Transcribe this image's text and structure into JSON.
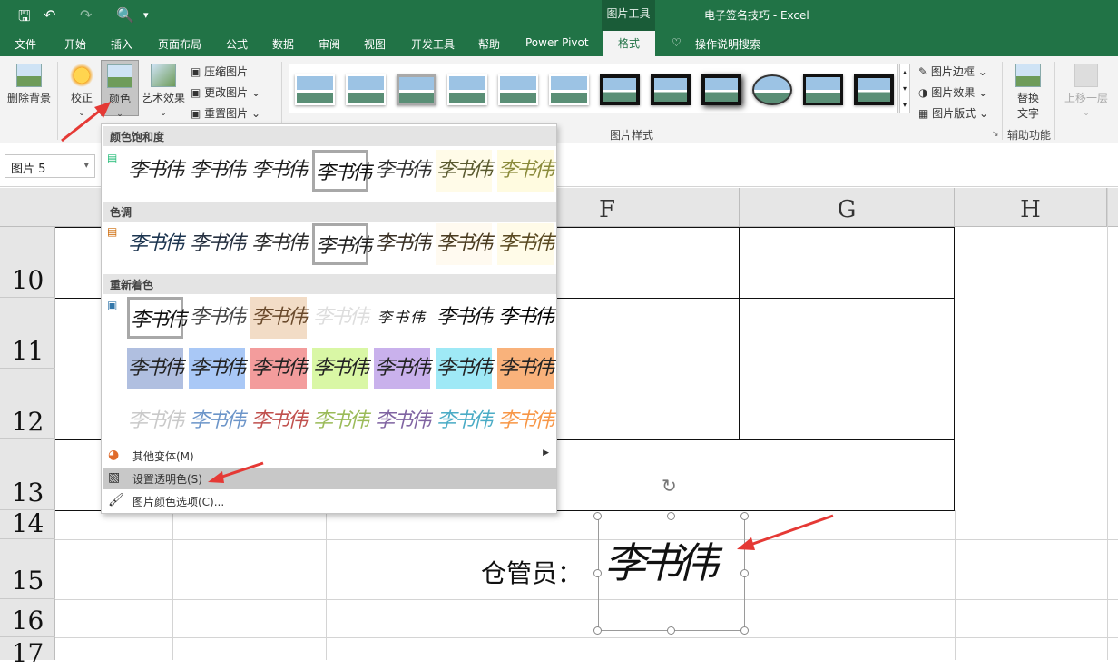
{
  "app": {
    "document_title": "电子签名技巧 - Excel",
    "context_tool": "图片工具"
  },
  "tabs": [
    "文件",
    "开始",
    "插入",
    "页面布局",
    "公式",
    "数据",
    "审阅",
    "视图",
    "开发工具",
    "帮助",
    "Power Pivot",
    "格式",
    "操作说明搜索"
  ],
  "ribbon": {
    "remove_bg": "删除背景",
    "correct": "校正",
    "color": "颜色",
    "artistic": "艺术效果",
    "compress": "压缩图片",
    "change": "更改图片",
    "reset": "重置图片",
    "styles_group": "图片样式",
    "border": "图片边框",
    "effects": "图片效果",
    "layout": "图片版式",
    "alt_text_1": "替换",
    "alt_text_2": "文字",
    "accessibility": "辅助功能",
    "bring_forward": "上移一层"
  },
  "namebox": "图片 5",
  "columns": [
    "F",
    "G",
    "H"
  ],
  "rows": [
    "10",
    "11",
    "12",
    "13",
    "14",
    "15",
    "16",
    "17"
  ],
  "menu": {
    "saturation_header": "颜色饱和度",
    "tone_header": "色调",
    "recolor_header": "重新着色",
    "more_variants": "其他变体(M)",
    "set_transparent": "设置透明色(S)",
    "color_options": "图片颜色选项(C)...",
    "thumb_text": "李书伟",
    "recolor_fills": [
      "#b0bfe0",
      "#a9c8f6",
      "#f39c9c",
      "#d9f7a5",
      "#c9b1ec",
      "#9fe9f6",
      "#f9b27b"
    ],
    "recolor_inks": [
      "#c9c9c9",
      "#6c95c9",
      "#c0504d",
      "#9bbb59",
      "#8064a2",
      "#4bacc6",
      "#f79646"
    ]
  },
  "sheet": {
    "keeper_label": "仓管员：",
    "signature": "李书伟"
  }
}
